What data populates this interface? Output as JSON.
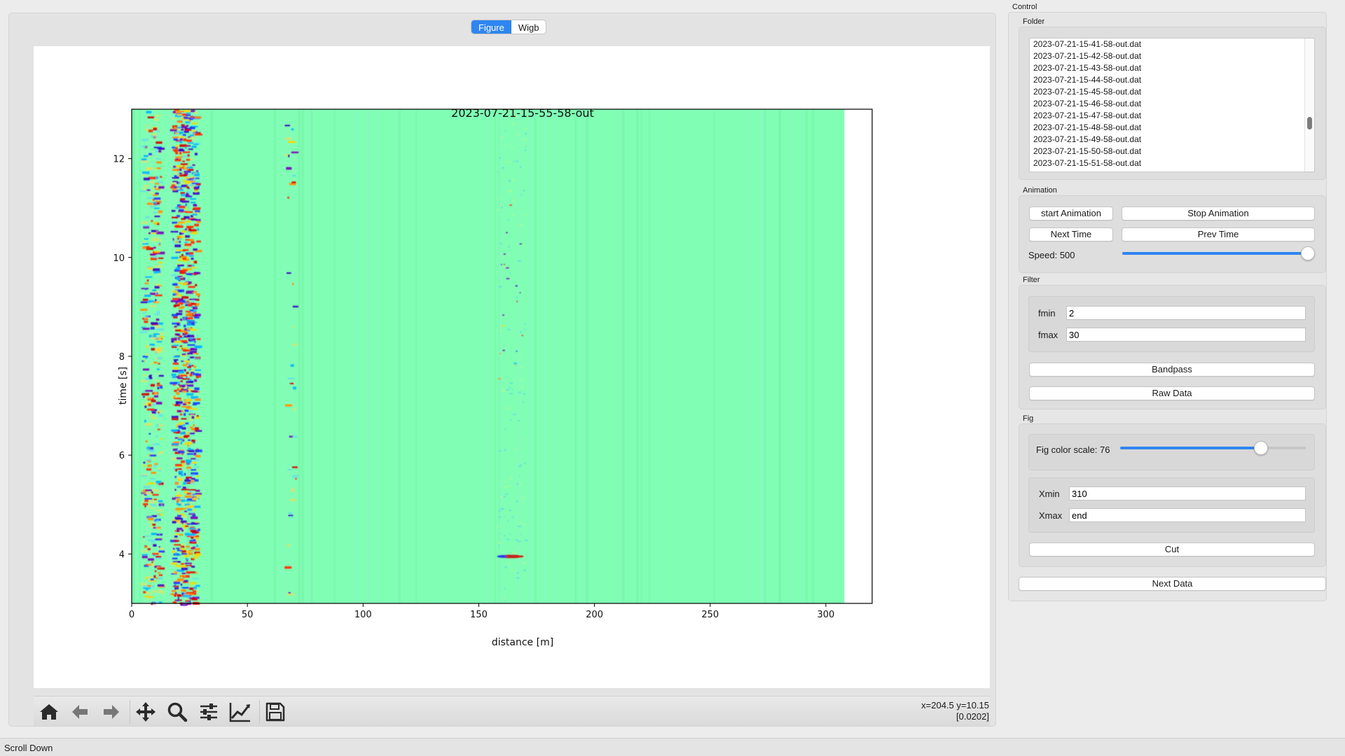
{
  "tabs": [
    {
      "label": "Figure",
      "active": true
    },
    {
      "label": "Wigb",
      "active": false
    }
  ],
  "chart_data": {
    "type": "heatmap",
    "title": "2023-07-21-15-55-58-out",
    "xlabel": "distance [m]",
    "ylabel": "time [s]",
    "xlim": [
      0,
      320
    ],
    "ylim": [
      3,
      13
    ],
    "data_x_extent": [
      0,
      308
    ],
    "x_ticks": [
      0,
      50,
      100,
      150,
      200,
      250,
      300
    ],
    "y_ticks": [
      4,
      6,
      8,
      10,
      12
    ],
    "colormap": "jet",
    "background_color": "#80ffb4",
    "notes_visible_features": [
      {
        "distance": [
          5,
          30
        ],
        "time": [
          3,
          13
        ],
        "desc": "strong oscillating signal band"
      },
      {
        "distance": [
          68,
          70
        ],
        "time": [
          3,
          13
        ],
        "desc": "weak vertical trace"
      },
      {
        "distance": [
          158,
          170
        ],
        "time": [
          3.9,
          4.0
        ],
        "desc": "bright event"
      },
      {
        "distance": [
          160,
          170
        ],
        "time": [
          7.5,
          11.5
        ],
        "desc": "intermittent trace"
      }
    ]
  },
  "toolbar": {
    "icons": [
      "home-icon",
      "back-arrow-icon",
      "forward-arrow-icon",
      "pan-icon",
      "zoom-icon",
      "subplots-icon",
      "edit-curve-icon",
      "save-icon"
    ],
    "coord_line1": "x=204.5 y=10.15",
    "coord_line2": "[0.0202]"
  },
  "control": {
    "title": "Control",
    "folder": {
      "label": "Folder",
      "files": [
        "2023-07-21-15-41-58-out.dat",
        "2023-07-21-15-42-58-out.dat",
        "2023-07-21-15-43-58-out.dat",
        "2023-07-21-15-44-58-out.dat",
        "2023-07-21-15-45-58-out.dat",
        "2023-07-21-15-46-58-out.dat",
        "2023-07-21-15-47-58-out.dat",
        "2023-07-21-15-48-58-out.dat",
        "2023-07-21-15-49-58-out.dat",
        "2023-07-21-15-50-58-out.dat",
        "2023-07-21-15-51-58-out.dat"
      ]
    },
    "animation": {
      "label": "Animation",
      "start": "start Animation",
      "stop": "Stop Animation",
      "next": "Next Time",
      "prev": "Prev Time",
      "speed_label": "Speed: 500",
      "speed_fraction": 1.0
    },
    "filter": {
      "label": "Filter",
      "fmin_label": "fmin",
      "fmin_value": "2",
      "fmax_label": "fmax",
      "fmax_value": "30",
      "bandpass": "Bandpass",
      "raw": "Raw Data"
    },
    "fig": {
      "label": "Fig",
      "scale_label": "Fig color scale: 76",
      "scale_fraction": 0.76,
      "xmin_label": "Xmin",
      "xmin_value": "310",
      "xmax_label": "Xmax",
      "xmax_value": "end",
      "cut": "Cut"
    },
    "next_data": "Next Data"
  },
  "status": "Scroll Down"
}
